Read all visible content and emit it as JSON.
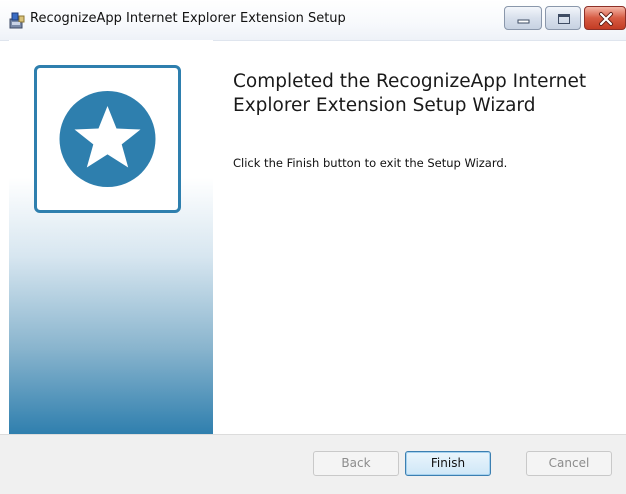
{
  "window": {
    "title": "RecognizeApp Internet Explorer Extension Setup",
    "controls": [
      "minimize-icon",
      "maximize-icon",
      "close-icon"
    ]
  },
  "banner": {
    "logo_icon": "star-icon",
    "accent_color": "#2e7fae"
  },
  "content": {
    "heading": "Completed the RecognizeApp Internet Explorer Extension Setup Wizard",
    "body": "Click the Finish button to exit the Setup Wizard."
  },
  "footer": {
    "back_label": "Back",
    "finish_label": "Finish",
    "cancel_label": "Cancel"
  }
}
